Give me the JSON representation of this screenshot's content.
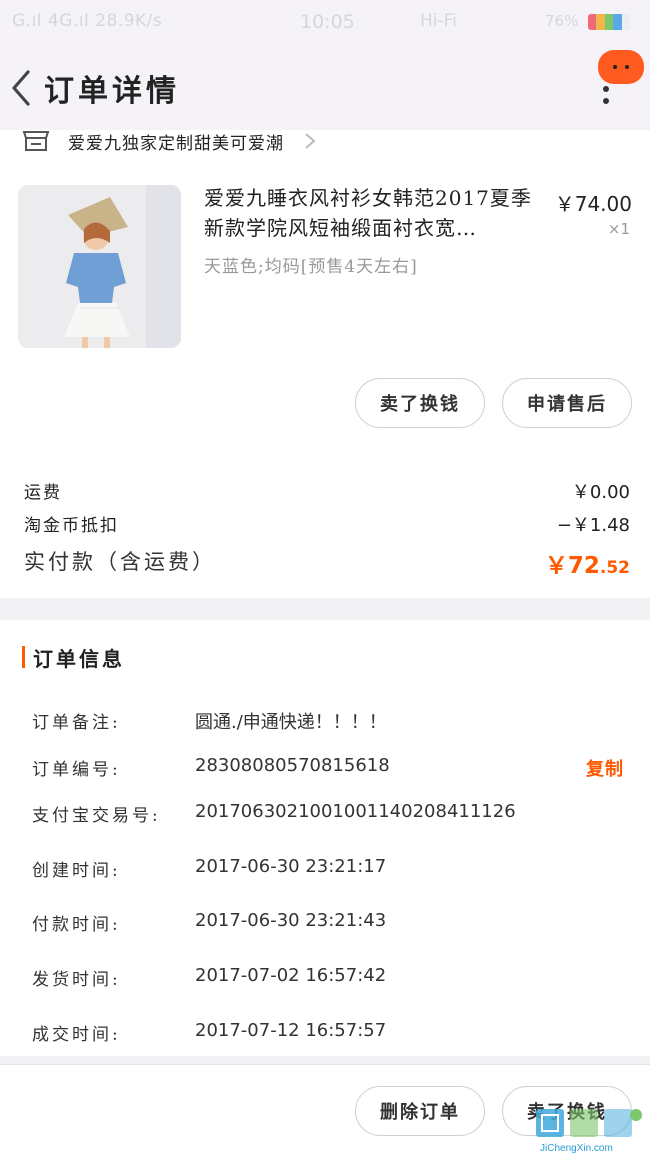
{
  "status_bar": {
    "left": "G.ıl 4G.ıl 28.9K/s",
    "time": "10:05",
    "right": "Hi-Fi",
    "battery": "76%"
  },
  "header": {
    "title": "订单详情"
  },
  "shop": {
    "name": "爱爱九独家定制甜美可爱潮"
  },
  "product": {
    "title": "爱爱九睡衣风衬衫女韩范2017夏季新款学院风短袖缎面衬衣宽…",
    "sku": "天蓝色;均码[预售4天左右]",
    "price": "￥74.00",
    "qty": "×1"
  },
  "actions": {
    "sell": "卖了换钱",
    "after_sale": "申请售后"
  },
  "fees": {
    "shipping_label": "运费",
    "shipping_value": "￥0.00",
    "coin_label": "淘金币抵扣",
    "coin_value": "−￥1.48",
    "paid_label": "实付款（含运费）",
    "paid_int": "￥72",
    "paid_dec": ".52"
  },
  "order_info": {
    "title": "订单信息",
    "rows": [
      {
        "k": "订单备注:",
        "v": "圆通./申通快递！！！！"
      },
      {
        "k": "订单编号:",
        "v": "2830808057081561​8"
      },
      {
        "k": "支付宝交易号:",
        "v": "2017063021001001140208411126"
      },
      {
        "k": "创建时间:",
        "v": "2017-06-30 23:21:17"
      },
      {
        "k": "付款时间:",
        "v": "2017-06-30 23:21:43"
      },
      {
        "k": "发货时间:",
        "v": "2017-07-02 16:57:42"
      },
      {
        "k": "成交时间:",
        "v": "2017-07-12 16:57:57"
      }
    ],
    "copy_label": "复制"
  },
  "bottom_bar": {
    "delete": "删除订单",
    "sell": "卖了换钱"
  },
  "watermark": {
    "site": "JiChengXin.com"
  },
  "colors": {
    "accent": "#ff5a00",
    "bubble": "#ff5a1f"
  }
}
